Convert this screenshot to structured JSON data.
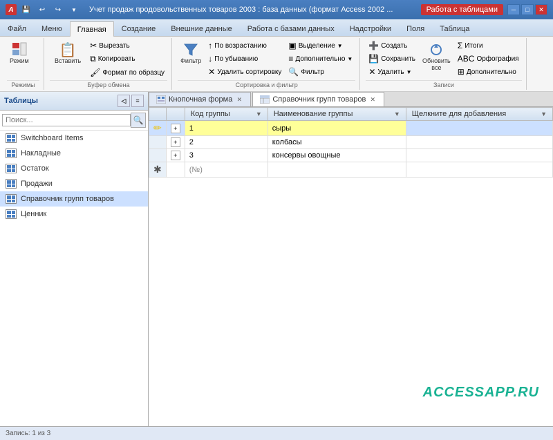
{
  "titlebar": {
    "icon_label": "A",
    "title": "Учет продаж продовольственных товаров 2003 : база данных (формат Access 2002 ...",
    "work_tables_label": "Работа с таблицами",
    "btn_minimize": "─",
    "btn_restore": "□",
    "btn_close": "✕"
  },
  "ribbon": {
    "tabs": [
      {
        "label": "Файл",
        "active": false
      },
      {
        "label": "Меню",
        "active": false
      },
      {
        "label": "Главная",
        "active": true
      },
      {
        "label": "Создание",
        "active": false
      },
      {
        "label": "Внешние данные",
        "active": false
      },
      {
        "label": "Работа с базами данных",
        "active": false
      },
      {
        "label": "Надстройки",
        "active": false
      },
      {
        "label": "Поля",
        "active": false
      },
      {
        "label": "Таблица",
        "active": false
      }
    ],
    "groups": {
      "rezhimy": {
        "label": "Режимы",
        "btn_rezhim": "Режим"
      },
      "bufer": {
        "label": "Буфер обмена",
        "btn_paste": "Вставить",
        "btn_cut": "Вырезать",
        "btn_copy": "Копировать",
        "btn_format": "Формат по образцу"
      },
      "sort": {
        "label": "Сортировка и фильтр",
        "btn_filter": "Фильтр",
        "btn_asc": "По возрастанию",
        "btn_desc": "По убыванию",
        "btn_del_sort": "Удалить сортировку",
        "btn_select": "Выделение",
        "btn_more": "Дополнительно",
        "btn_filter2": "Фильтр"
      },
      "zapisi": {
        "label": "Записи",
        "btn_create": "Создать",
        "btn_save": "Сохранить",
        "btn_delete": "Удалить",
        "btn_itogi": "Итоги",
        "btn_orfogr": "Орфография",
        "btn_dop": "Дополнительно",
        "btn_refresh": "Обновить все"
      }
    }
  },
  "leftpanel": {
    "title": "Таблицы",
    "search_placeholder": "Поиск...",
    "items": [
      {
        "label": "Switchboard Items"
      },
      {
        "label": "Накладные"
      },
      {
        "label": "Остаток"
      },
      {
        "label": "Продажи"
      },
      {
        "label": "Справочник групп товаров"
      },
      {
        "label": "Ценник"
      }
    ]
  },
  "tabs": [
    {
      "label": "Кнопочная форма",
      "active": false
    },
    {
      "label": "Справочник групп товаров",
      "active": true
    }
  ],
  "table": {
    "columns": [
      {
        "label": "Код группы",
        "sort": "▼"
      },
      {
        "label": "Наименование группы",
        "sort": "▼"
      },
      {
        "label": "Щелкните для добавления",
        "sort": "▼"
      }
    ],
    "rows": [
      {
        "id": "1",
        "name": "сыры",
        "selected": true
      },
      {
        "id": "2",
        "name": "колбасы",
        "selected": false
      },
      {
        "id": "3",
        "name": "консервы овощные",
        "selected": false
      }
    ],
    "new_row_placeholder": "(№)"
  },
  "watermark": "ACCESSAPP.RU",
  "status": {
    "record_info": "Запись: 1 из 3"
  }
}
